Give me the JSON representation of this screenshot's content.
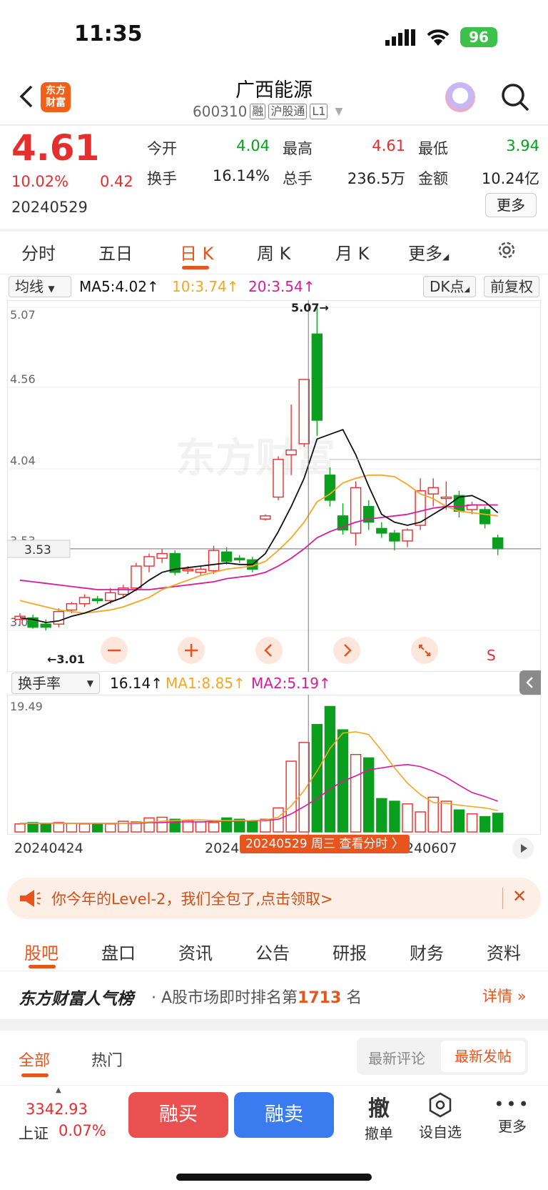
{
  "status": {
    "time": "11:35",
    "battery": "96"
  },
  "header": {
    "title": "广西能源",
    "code": "600310",
    "tags": [
      "融",
      "沪股通",
      "L1"
    ],
    "logo_text_1": "东方",
    "logo_text_2": "财富"
  },
  "quote": {
    "price": "4.61",
    "change_pct": "10.02%",
    "change": "0.42",
    "date": "20240529",
    "open_label": "今开",
    "open": "4.04",
    "high_label": "最高",
    "high": "4.61",
    "low_label": "最低",
    "low": "3.94",
    "turnover_label": "换手",
    "turnover": "16.14%",
    "volume_label": "总手",
    "volume": "236.5万",
    "amount_label": "金额",
    "amount": "10.24亿",
    "more": "更多"
  },
  "ktabs": [
    "分时",
    "五日",
    "日 K",
    "周 K",
    "月 K",
    "更多"
  ],
  "ma_bar": {
    "select": "均线",
    "ma5": "MA5:4.02↑",
    "ma10": "10:3.74↑",
    "ma20": "20:3.54↑",
    "dk": "DK点",
    "fq": "前复权"
  },
  "chart_data": {
    "type": "candlestick",
    "y_labels": [
      "5.07",
      "4.56",
      "4.04",
      "3.53",
      "3.01"
    ],
    "ylim": [
      3.01,
      5.07
    ],
    "high_marker": "5.07",
    "low_marker": "3.01",
    "cursor_price": "3.53",
    "signal": "S",
    "candles": [
      [
        3.08,
        3.1,
        3.04,
        3.12
      ],
      [
        3.09,
        3.03,
        3.02,
        3.11
      ],
      [
        3.05,
        3.03,
        3.01,
        3.08
      ],
      [
        3.05,
        3.13,
        3.03,
        3.15
      ],
      [
        3.14,
        3.18,
        3.12,
        3.19
      ],
      [
        3.18,
        3.22,
        3.16,
        3.24
      ],
      [
        3.21,
        3.2,
        3.18,
        3.23
      ],
      [
        3.2,
        3.25,
        3.18,
        3.28
      ],
      [
        3.24,
        3.28,
        3.22,
        3.3
      ],
      [
        3.28,
        3.42,
        3.26,
        3.44
      ],
      [
        3.42,
        3.48,
        3.38,
        3.5
      ],
      [
        3.47,
        3.5,
        3.44,
        3.53
      ],
      [
        3.5,
        3.38,
        3.36,
        3.52
      ],
      [
        3.39,
        3.4,
        3.37,
        3.42
      ],
      [
        3.38,
        3.4,
        3.36,
        3.42
      ],
      [
        3.39,
        3.52,
        3.37,
        3.55
      ],
      [
        3.51,
        3.45,
        3.43,
        3.54
      ],
      [
        3.47,
        3.46,
        3.44,
        3.49
      ],
      [
        3.46,
        3.4,
        3.38,
        3.48
      ],
      [
        3.72,
        3.74,
        3.71,
        3.75
      ],
      [
        3.86,
        4.1,
        3.84,
        4.12
      ],
      [
        4.13,
        4.16,
        4.0,
        4.45
      ],
      [
        4.2,
        4.61,
        4.18,
        4.61
      ],
      [
        4.9,
        4.35,
        4.25,
        5.07
      ],
      [
        4.0,
        3.84,
        3.8,
        4.05
      ],
      [
        3.74,
        3.65,
        3.62,
        3.82
      ],
      [
        3.63,
        3.92,
        3.55,
        3.96
      ],
      [
        3.8,
        3.7,
        3.65,
        3.84
      ],
      [
        3.66,
        3.63,
        3.6,
        3.7
      ],
      [
        3.63,
        3.58,
        3.52,
        3.65
      ],
      [
        3.58,
        3.65,
        3.54,
        3.66
      ],
      [
        3.68,
        3.9,
        3.65,
        3.98
      ],
      [
        3.88,
        3.92,
        3.8,
        3.98
      ],
      [
        3.86,
        3.86,
        3.78,
        3.96
      ],
      [
        3.87,
        3.77,
        3.73,
        3.9
      ],
      [
        3.78,
        3.81,
        3.75,
        3.83
      ],
      [
        3.78,
        3.69,
        3.66,
        3.8
      ],
      [
        3.6,
        3.53,
        3.49,
        3.62
      ]
    ],
    "ma5": [
      3.09,
      3.08,
      3.06,
      3.07,
      3.1,
      3.12,
      3.15,
      3.19,
      3.22,
      3.27,
      3.33,
      3.38,
      3.4,
      3.41,
      3.42,
      3.43,
      3.44,
      3.43,
      3.43,
      3.5,
      3.64,
      3.8,
      3.98,
      4.23,
      4.26,
      4.29,
      4.13,
      3.93,
      3.75,
      3.7,
      3.68,
      3.7,
      3.75,
      3.8,
      3.86,
      3.87,
      3.83,
      3.76
    ],
    "ma10": [
      3.2,
      3.18,
      3.16,
      3.14,
      3.13,
      3.12,
      3.13,
      3.14,
      3.16,
      3.19,
      3.22,
      3.27,
      3.3,
      3.33,
      3.36,
      3.38,
      3.4,
      3.41,
      3.42,
      3.45,
      3.52,
      3.6,
      3.7,
      3.83,
      3.88,
      3.95,
      3.98,
      4.0,
      4.0,
      3.99,
      3.94,
      3.88,
      3.85,
      3.8,
      3.77,
      3.76,
      3.75,
      3.74
    ],
    "ma20": [
      3.33,
      3.32,
      3.31,
      3.3,
      3.29,
      3.28,
      3.27,
      3.27,
      3.27,
      3.27,
      3.27,
      3.28,
      3.29,
      3.3,
      3.31,
      3.32,
      3.34,
      3.35,
      3.36,
      3.38,
      3.42,
      3.47,
      3.53,
      3.6,
      3.64,
      3.67,
      3.7,
      3.72,
      3.73,
      3.74,
      3.75,
      3.77,
      3.79,
      3.8,
      3.8,
      3.81,
      3.81,
      3.81
    ],
    "turnover_ylim": [
      0,
      19.49
    ],
    "turnover": [
      1.2,
      1.4,
      1.3,
      1.4,
      1.3,
      1.2,
      1.3,
      1.2,
      1.6,
      1.5,
      2.1,
      2.2,
      1.9,
      1.7,
      1.5,
      1.4,
      2.1,
      1.9,
      1.6,
      1.9,
      3.6,
      10.6,
      13.4,
      16.1,
      18.8,
      15.3,
      11.6,
      11.1,
      5.0,
      4.6,
      4.2,
      3.0,
      5.2,
      4.6,
      3.3,
      2.7,
      2.3,
      2.8
    ],
    "turnover_ma1": [
      1.3,
      1.3,
      1.3,
      1.3,
      1.3,
      1.3,
      1.3,
      1.3,
      1.3,
      1.4,
      1.5,
      1.6,
      1.7,
      1.8,
      1.8,
      1.7,
      1.7,
      1.7,
      1.7,
      1.8,
      2.2,
      3.9,
      6.2,
      9.1,
      12.5,
      14.8,
      15.0,
      14.6,
      12.2,
      9.6,
      7.3,
      5.6,
      4.4,
      4.3,
      4.0,
      3.8,
      3.6,
      3.2
    ],
    "turnover_ma2": [
      1.3,
      1.3,
      1.3,
      1.3,
      1.3,
      1.3,
      1.3,
      1.3,
      1.3,
      1.3,
      1.4,
      1.4,
      1.5,
      1.5,
      1.5,
      1.6,
      1.6,
      1.6,
      1.7,
      1.7,
      1.9,
      2.7,
      3.8,
      5.0,
      6.4,
      7.6,
      8.4,
      9.3,
      9.6,
      9.9,
      10.1,
      9.8,
      9.1,
      8.2,
      7.0,
      5.9,
      5.3,
      4.6
    ]
  },
  "vol_bar": {
    "select": "换手率",
    "value": "16.14↑",
    "ma1": "MA1:8.85↑",
    "ma2": "MA2:5.19↑",
    "ymax": "19.49"
  },
  "dates": {
    "start": "20240424",
    "mid": "2024",
    "end": "240607",
    "tooltip": "20240529 周三 查看分时"
  },
  "promo": {
    "text": "你今年的Level-2，我们全包了,点击领取>"
  },
  "gtabs": [
    "股吧",
    "盘口",
    "资讯",
    "公告",
    "研报",
    "财务",
    "资料"
  ],
  "rank": {
    "brand": "东方财富人气榜",
    "text": "A股市场即时排名第",
    "rank": "1713",
    "suffix": "名",
    "detail": "详情"
  },
  "feed": {
    "all": "全部",
    "hot": "热门",
    "latest_comment": "最新评论",
    "latest_post": "最新发帖"
  },
  "bottom": {
    "index": "3342.93",
    "index_name": "上证",
    "index_pct": "0.07%",
    "buy": "融买",
    "sell": "融卖",
    "cancel": "撤单",
    "cancel_glyph": "撤",
    "watch": "设自选",
    "more": "更多"
  },
  "colors": {
    "up": "#e52e2e",
    "down": "#0a9f1e",
    "accent": "#e8541e",
    "ma5": "#111111",
    "ma10": "#f5a623",
    "ma20": "#d81b9b"
  }
}
